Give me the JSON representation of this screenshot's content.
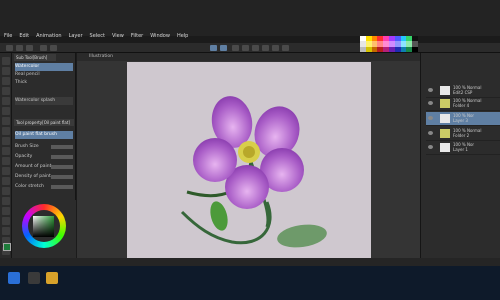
{
  "menu": [
    "File",
    "Edit",
    "Animation",
    "Layer",
    "Select",
    "View",
    "Filter",
    "Window",
    "Help"
  ],
  "subtool": {
    "tabs": [
      "Sub Tool[Brush]"
    ],
    "items": [
      "Watercolor",
      "Real pencil",
      "Thick"
    ],
    "section1": "Watercolor splash",
    "tool_property": "Tool property[Oil paint flat]",
    "selected_brush": "Oil paint flat brush",
    "properties": [
      "Brush Size",
      "Opacity",
      "Amount of paint",
      "Density of paint",
      "Color stretch"
    ]
  },
  "document": {
    "tab": "Illustration"
  },
  "swatch_colors": [
    "#ffffff",
    "#ffe000",
    "#ff8a00",
    "#ff2f2f",
    "#ff3fb0",
    "#a43bff",
    "#4d5cff",
    "#25c6ff",
    "#35d46a",
    "#111111",
    "#e6e6e6",
    "#fff36b",
    "#ffc16b",
    "#ff8686",
    "#ff8bd3",
    "#cf8bff",
    "#8f97ff",
    "#8be3ff",
    "#8feaa9",
    "#555555",
    "#bbbbbb",
    "#d4c200",
    "#c46a00",
    "#b81e1e",
    "#b5207a",
    "#6b1fb3",
    "#1f2cb3",
    "#0f7fb0",
    "#18884a",
    "#000000"
  ],
  "layers": [
    {
      "line1": "100 % Normal",
      "line2": "Edit2 CSP"
    },
    {
      "line1": "100 % Normal",
      "line2": "Folder 4"
    },
    {
      "line1": "100 % Nor",
      "line2": "Layer 3"
    },
    {
      "line1": "100 % Normal",
      "line2": "Folder 2"
    },
    {
      "line1": "100 % Nor",
      "line2": "Layer 1"
    }
  ],
  "colors": {
    "accent": "#5f7fa3",
    "foreground": "#1d7b3a"
  }
}
